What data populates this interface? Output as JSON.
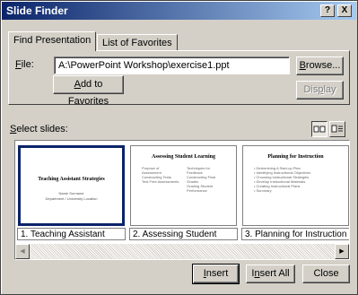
{
  "title": "Slide Finder",
  "titlebar_buttons": {
    "help": "?",
    "close": "X"
  },
  "tabs": [
    {
      "label": "Find Presentation",
      "active": true
    },
    {
      "label": "List of Favorites",
      "active": false
    }
  ],
  "file": {
    "label": "File:",
    "value": "A:\\PowerPoint Workshop\\exercise1.ppt"
  },
  "buttons": {
    "browse": "Browse...",
    "add_favorites": "Add to Favorites",
    "display": "Display",
    "insert": "Insert",
    "insert_all": "Insert All",
    "close": "Close"
  },
  "select_slides_label": "Select slides:",
  "view_buttons": [
    "slide-view-icon",
    "title-list-icon"
  ],
  "slides": [
    {
      "caption": "1. Teaching Assistant",
      "thumb_title": "Teaching Assistant Strategies",
      "thumb_sub": [
        "Name Surname",
        "Department / University Location"
      ],
      "selected": true
    },
    {
      "caption": "2. Assessing Student",
      "thumb_title": "Assessing Student Learning",
      "col1": [
        "Purpose of",
        "Assessment",
        "Constructing Tests",
        "Test Free Assessments"
      ],
      "col2": [
        "Techniques for",
        "Feedback",
        "Constructing Final",
        "Grades",
        "Grading Student",
        "Performance"
      ],
      "selected": false
    },
    {
      "caption": "3. Planning for Instruction",
      "thumb_title": "Planning for Instruction",
      "bullets": [
        "Determining A Start-up Plan",
        "Identifying Instructional Objectives",
        "Choosing Instructional Strategies",
        "Develop Instructional Materials",
        "Creating Instructional Plans",
        "Summary"
      ],
      "selected": false
    }
  ],
  "colors": {
    "titlebar_start": "#0a246a",
    "titlebar_end": "#a6caf0",
    "face": "#d4d0c8",
    "selection": "#0a246a"
  }
}
